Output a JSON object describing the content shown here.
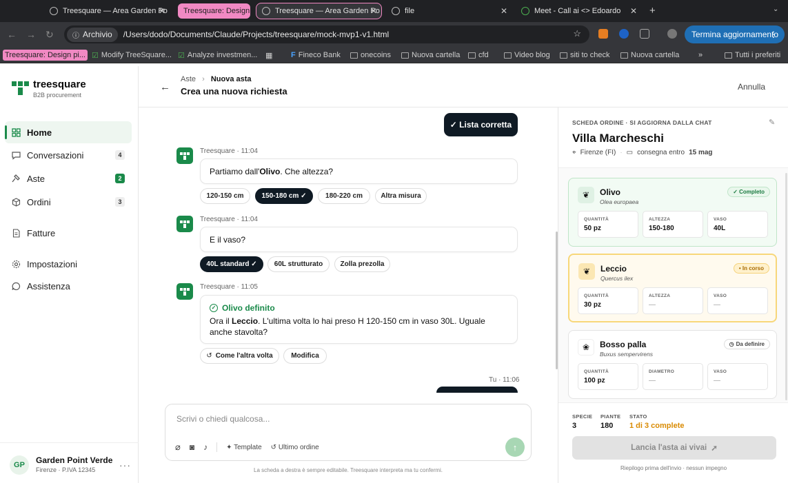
{
  "browser": {
    "tabs": [
      {
        "title": "Treesquare — Area Garden Po",
        "style": "normal"
      },
      {
        "title": "Treesquare: Design",
        "style": "pink"
      },
      {
        "title": "Treesquare — Area Garden Po",
        "style": "active"
      },
      {
        "title": "file",
        "style": "normal"
      },
      {
        "title": "Meet - Call ai <> Edoardo",
        "style": "normal"
      }
    ],
    "site_chip": "Archivio",
    "url": "/Users/dodo/Documents/Claude/Projects/treesquare/mock-mvp1-v1.html",
    "update_label": "Termina aggiornamento",
    "bookmarks": [
      "Treesquare: Design pi...",
      "Modify TreeSquare...",
      "Analyze investmen...",
      "Fineco Bank",
      "onecoins",
      "Nuova cartella",
      "cfd",
      "Video blog",
      "siti to check",
      "Nuova cartella"
    ],
    "all_bookmarks": "Tutti i preferiti"
  },
  "brand": {
    "name": "treesquare",
    "tagline": "B2B procurement",
    "accent": "#1a8a4a"
  },
  "nav": [
    {
      "label": "Home",
      "icon": "grid-icon",
      "badge": ""
    },
    {
      "label": "Conversazioni",
      "icon": "chat-icon",
      "badge": "4"
    },
    {
      "label": "Aste",
      "icon": "gavel-icon",
      "badge": "2"
    },
    {
      "label": "Ordini",
      "icon": "box-icon",
      "badge": "3"
    },
    {
      "label": "Fatture",
      "icon": "document-icon",
      "badge": ""
    },
    {
      "label": "Impostazioni",
      "icon": "gear-icon",
      "badge": ""
    },
    {
      "label": "Assistenza",
      "icon": "help-chat-icon",
      "badge": ""
    }
  ],
  "user": {
    "initials": "GP",
    "name": "Garden Point Verde",
    "vat": "Firenze · P.IVA 12345"
  },
  "header": {
    "crumb_parent": "Aste",
    "crumb_current": "Nuova asta",
    "title": "Crea una nuova richiesta",
    "cancel": "Annulla"
  },
  "chat": {
    "user_msg_1": "✓ Lista corretta",
    "msg1": {
      "meta": "Treesquare · 11:04",
      "pre": "Partiamo dall'",
      "bold": "Olivo",
      "post": ". Che altezza?",
      "options": [
        "120-150 cm",
        "150-180 cm ✓",
        "180-220 cm",
        "Altra misura"
      ]
    },
    "msg2": {
      "meta": "Treesquare · 11:04",
      "text": "E il vaso?",
      "options": [
        "40L standard ✓",
        "60L strutturato",
        "Zolla prezolla"
      ]
    },
    "msg3": {
      "meta": "Treesquare · 11:05",
      "heading": "Olivo definito",
      "pre": "Ora il ",
      "bold": "Leccio",
      "post": ". L'ultima volta lo hai preso H 120-150 cm in vaso 30L. Uguale anche stavolta?",
      "options": [
        "Come l'altra volta",
        "Modifica"
      ]
    },
    "user_meta_2": "Tu · 11:06"
  },
  "composer": {
    "placeholder": "Scrivi o chiedi qualcosa...",
    "template": "Template",
    "last_order": "Ultimo ordine",
    "disclaimer": "La scheda a destra è sempre editabile. Treesquare interpreta ma tu confermi."
  },
  "order": {
    "label": "SCHEDA ORDINE · SI AGGIORNA DALLA CHAT",
    "title": "Villa Marcheschi",
    "location": "Firenze (FI)",
    "delivery_pre": "consegna entro",
    "delivery_date": "15 mag",
    "items": [
      {
        "name": "Olivo",
        "latin": "Olea europaea",
        "status": "✓ Completo",
        "fields": [
          {
            "label": "QUANTITÀ",
            "value": "50 pz"
          },
          {
            "label": "ALTEZZA",
            "value": "150-180"
          },
          {
            "label": "VASO",
            "value": "40L"
          }
        ]
      },
      {
        "name": "Leccio",
        "latin": "Quercus ilex",
        "status": "• In corso",
        "fields": [
          {
            "label": "QUANTITÀ",
            "value": "30 pz"
          },
          {
            "label": "ALTEZZA",
            "value": "—"
          },
          {
            "label": "VASO",
            "value": "—"
          }
        ]
      },
      {
        "name": "Bosso palla",
        "latin": "Buxus sempervirens",
        "status": "Da definire",
        "fields": [
          {
            "label": "QUANTITÀ",
            "value": "100 pz"
          },
          {
            "label": "DIAMETRO",
            "value": "—"
          },
          {
            "label": "VASO",
            "value": "—"
          }
        ]
      }
    ],
    "stats": [
      {
        "label": "SPECIE",
        "value": "3"
      },
      {
        "label": "PIANTE",
        "value": "180"
      },
      {
        "label": "STATO",
        "value": "1 di 3 complete"
      }
    ],
    "launch": "Lancia l'asta ai vivai",
    "note": "Riepilogo prima dell'invio · nessun impegno"
  }
}
